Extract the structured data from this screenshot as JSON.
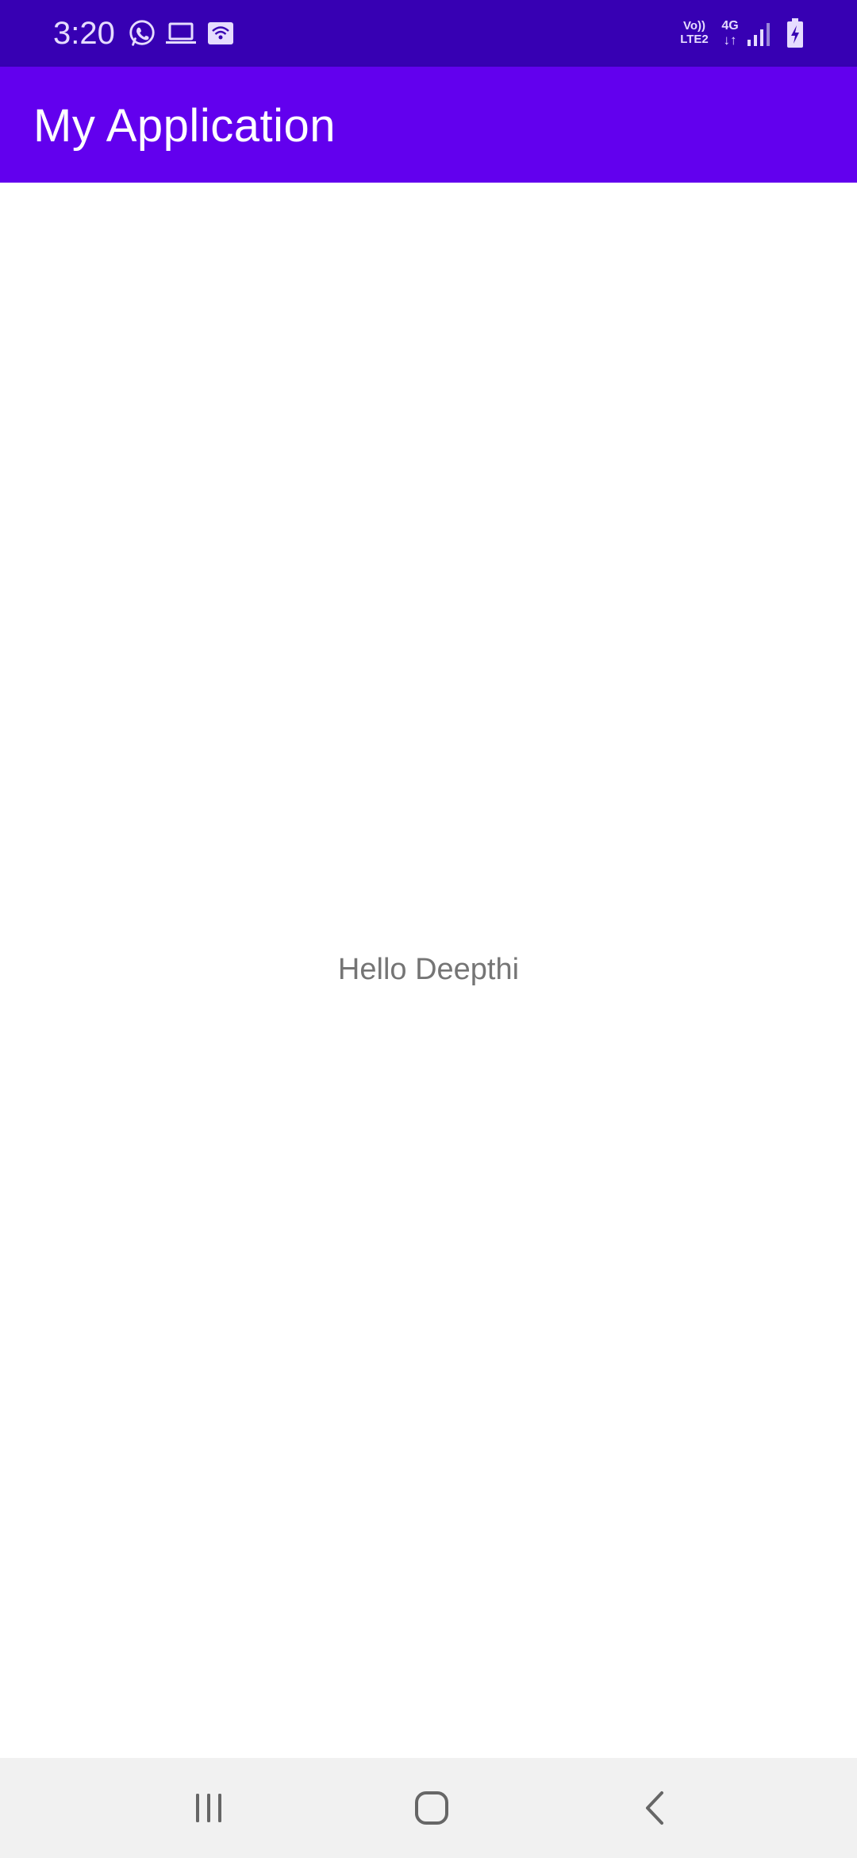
{
  "status_bar": {
    "time": "3:20",
    "volte_line1": "Vo))",
    "volte_line2": "LTE2",
    "network_type": "4G",
    "icons": [
      "whatsapp-icon",
      "laptop-icon",
      "wifi-hotspot-icon",
      "signal-icon",
      "battery-charging-icon"
    ]
  },
  "app_bar": {
    "title": "My Application"
  },
  "main": {
    "text": "Hello Deepthi"
  },
  "nav_bar": {
    "buttons": [
      "recents",
      "home",
      "back"
    ]
  },
  "colors": {
    "status_bar": "#3700b3",
    "app_bar": "#6200ee",
    "text": "#757575",
    "nav_bar": "#f1f1f1"
  }
}
